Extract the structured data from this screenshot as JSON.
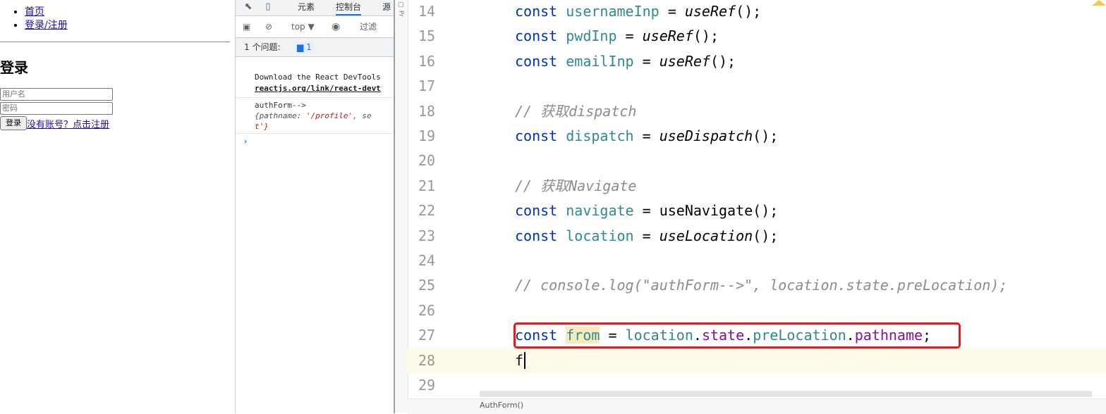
{
  "web_page": {
    "nav": [
      "首页",
      "登录/注册"
    ],
    "heading": "登录",
    "username_placeholder": "用户名",
    "password_placeholder": "密码",
    "login_button": "登录",
    "register_link": "没有账号？点击注册"
  },
  "devtools": {
    "tabs": [
      "元素",
      "控制台",
      "源"
    ],
    "active_tab": "控制台",
    "context": "top ▼",
    "filter_placeholder": "过滤",
    "issues_label": "1 个问题:",
    "issues_count": "1",
    "console": {
      "download_msg": "Download the React DevTools",
      "download_link": "reactjs.org/link/react-devt",
      "log_label": "authForm-->",
      "log_obj_line1_prefix": "{pathname: ",
      "log_obj_line1_str": "'/profile'",
      "log_obj_line1_suffix": ", se",
      "log_obj_line2": "t'}",
      "prompt": "›"
    }
  },
  "editor": {
    "lines": [
      {
        "n": "14"
      },
      {
        "n": "15"
      },
      {
        "n": "16"
      },
      {
        "n": "17"
      },
      {
        "n": "18"
      },
      {
        "n": "19"
      },
      {
        "n": "20"
      },
      {
        "n": "21"
      },
      {
        "n": "22"
      },
      {
        "n": "23"
      },
      {
        "n": "24"
      },
      {
        "n": "25"
      },
      {
        "n": "26"
      },
      {
        "n": "27"
      },
      {
        "n": "28"
      },
      {
        "n": "29"
      }
    ],
    "code": {
      "l14": {
        "kw": "const",
        "var": "usernameInp",
        "eq": " = ",
        "fn": "useRef",
        "end": "();"
      },
      "l15": {
        "kw": "const",
        "var": "pwdInp",
        "eq": " = ",
        "fn": "useRef",
        "end": "();"
      },
      "l16": {
        "kw": "const",
        "var": "emailInp",
        "eq": " = ",
        "fn": "useRef",
        "end": "();"
      },
      "l18": "// 获取dispatch",
      "l19": {
        "kw": "const",
        "var": "dispatch",
        "eq": " = ",
        "fn": "useDispatch",
        "end": "();"
      },
      "l21": "// 获取Navigate",
      "l22": {
        "kw": "const",
        "var": "navigate",
        "eq": " = ",
        "fn": "useNavigate",
        "end": "();"
      },
      "l23": {
        "kw": "const",
        "var": "location",
        "eq": " = ",
        "fn": "useLocation",
        "end": "();"
      },
      "l25": "// console.log(\"authForm-->\", location.state.preLocation);",
      "l27": {
        "kw": "const",
        "var": "from",
        "eq": " = ",
        "obj": "location",
        "p1": "state",
        "p2": "preLocation",
        "p3": "pathname",
        "end": ";"
      },
      "l28": "f"
    },
    "breadcrumb": "AuthForm()"
  },
  "colors": {
    "keyword": "#0033b3",
    "variable": "#2f8a8c",
    "comment": "#8c8c8c",
    "property": "#871094",
    "highlight_box": "#e8191a"
  }
}
